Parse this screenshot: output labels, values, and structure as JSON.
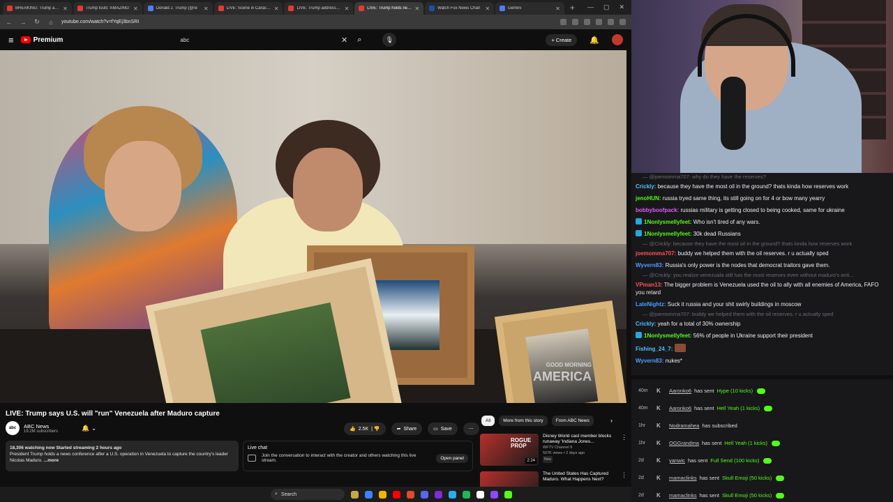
{
  "tabs": [
    {
      "title": "BREAKING: Trump annour",
      "fav": "yt"
    },
    {
      "title": "Trump touts 'AMAZING'",
      "fav": "yt"
    },
    {
      "title": "Donald J. Trump (@re",
      "fav": "truth"
    },
    {
      "title": "LIVE: Scene in Caracas af",
      "fav": "yt"
    },
    {
      "title": "LIVE: Trump addresses st",
      "fav": "yt"
    },
    {
      "title": "LIVE: Trump holds news c",
      "fav": "yt",
      "active": true
    },
    {
      "title": "Watch Fox News Chan",
      "fav": "fox"
    },
    {
      "title": "Gemini",
      "fav": "gem"
    }
  ],
  "address": {
    "url": "youtube.com/watch?v=fYqEj3bnSRI"
  },
  "yt": {
    "brand": "Premium",
    "search_value": "abc",
    "create_label": "Create"
  },
  "video": {
    "bug_line1": "GOOD MORNING",
    "bug_line2": "AMERICA",
    "title": "LIVE: Trump says U.S. will \"run\" Venezuela after Maduro capture",
    "channel": {
      "logo": "abc",
      "name": "ABC News",
      "subs": "19.2M subscribers"
    },
    "likes": "2.5K",
    "share": "Share",
    "save": "Save",
    "description_stats": "18,306 watching now  Started streaming 2 hours ago",
    "description_text": "President Trump holds a news conference after a U.S. operation in Venezuela to capture the country's leader Nicolas Maduro.",
    "description_more": "...more"
  },
  "livechat": {
    "title": "Live chat",
    "text": "Join the conversation to interact with the creator and others watching this live stream.",
    "open": "Open panel"
  },
  "chips": [
    "All",
    "More from this story",
    "From ABC News"
  ],
  "recs": [
    {
      "title": "Disney World cast member blocks runaway 'Indiana Jones...",
      "channel": "WFTV Channel 9",
      "meta": "507K views • 2 days ago",
      "badge": "New",
      "duration": "2:24",
      "thumb_text": "ROGUE PROP"
    },
    {
      "title": "The United States Has Captured Maduro. What Happens Next?",
      "channel": "",
      "meta": "",
      "badge": "",
      "duration": "",
      "thumb_text": ""
    }
  ],
  "taskbar": {
    "search": "Search"
  },
  "chat": [
    {
      "ghost": true,
      "text": "— @joemomma707: why do they have the reserves?"
    },
    {
      "user": "Crickly:",
      "color": "#4fc3f7",
      "text": "because they have the most oil in the ground? thats kinda how reserves work"
    },
    {
      "user": "jenoHUN:",
      "color": "#53fc18",
      "text": "russia tryed same thing, its still going on for 4 or bow many yearry"
    },
    {
      "user": "bobbyboofpack:",
      "color": "#e05cff",
      "text": "russias military is getting closed to being cooked, same for ukraine"
    },
    {
      "user": "1Nonlysmellyfeet:",
      "color": "#53fc18",
      "badge": true,
      "text": "Who isn't tired of any wars."
    },
    {
      "user": "1Nonlysmellyfeet:",
      "color": "#53fc18",
      "badge": true,
      "text": "30k dead Russians"
    },
    {
      "ghost": true,
      "text": "— @Crickly: because they have the most oil in the ground? thats kinda how reserves work"
    },
    {
      "user": "joemomma707:",
      "color": "#ff5252",
      "text": "buddy we helped them with the oil reserves. r u actually sped"
    },
    {
      "user": "Wyvern83:",
      "color": "#4f9dff",
      "text": "Russia's only power is the nodes that democrat traitors gave them."
    },
    {
      "ghost": true,
      "text": "— @Crickly: you realize venezuala still has the most reserves even without maduro's anti..."
    },
    {
      "user": "VPman13:",
      "color": "#ff5252",
      "text": "The bigger problem is Venezuela used the oil to ally with all enemies of America, FAFO you retard"
    },
    {
      "user": "LateNightz:",
      "color": "#4f9dff",
      "text": "Suck it russia and your shit swirly buildings in moscow"
    },
    {
      "ghost": true,
      "text": "— @joemomma707: buddy we helped them with the oil reserves. r u actually sped"
    },
    {
      "user": "Crickly:",
      "color": "#4fc3f7",
      "text": "yeah for a total of 30% ownership"
    },
    {
      "user": "1Nonlysmellyfeet:",
      "color": "#53fc18",
      "badge": true,
      "text": "56% of people in Ukraine support their president"
    },
    {
      "user": "Fishing_24_7:",
      "color": "#4fc3f7",
      "text": "",
      "emote": true
    },
    {
      "user": "Wyvern83:",
      "color": "#4f9dff",
      "text": "nukes*"
    }
  ],
  "events": [
    {
      "time": "40m",
      "user": "Aaronko6",
      "action": "has sent",
      "gift": "Hype (10 kicks)"
    },
    {
      "time": "40m",
      "user": "Aaronko6",
      "action": "has sent",
      "gift": "Hell Yeah (1 kicks)"
    },
    {
      "time": "1hr",
      "user": "Nodramahea",
      "action": "has subscribed",
      "gift": ""
    },
    {
      "time": "1hr",
      "user": "OGGrandma",
      "action": "has sent",
      "gift": "Hell Yeah (1 kicks)"
    },
    {
      "time": "2d",
      "user": "yanwic",
      "action": "has sent",
      "gift": "Full Send (100 kicks)"
    },
    {
      "time": "2d",
      "user": "mamaclinks",
      "action": "has sent",
      "gift": "Skull Emoji (50 kicks)"
    },
    {
      "time": "2d",
      "user": "mamaclinks",
      "action": "has sent",
      "gift": "Skull Emoji (50 kicks)"
    }
  ],
  "icons": {
    "menu": "hamburger-icon",
    "search": "search-icon",
    "mic": "microphone-icon",
    "bell": "bell-icon",
    "kick": "kick-icon"
  }
}
